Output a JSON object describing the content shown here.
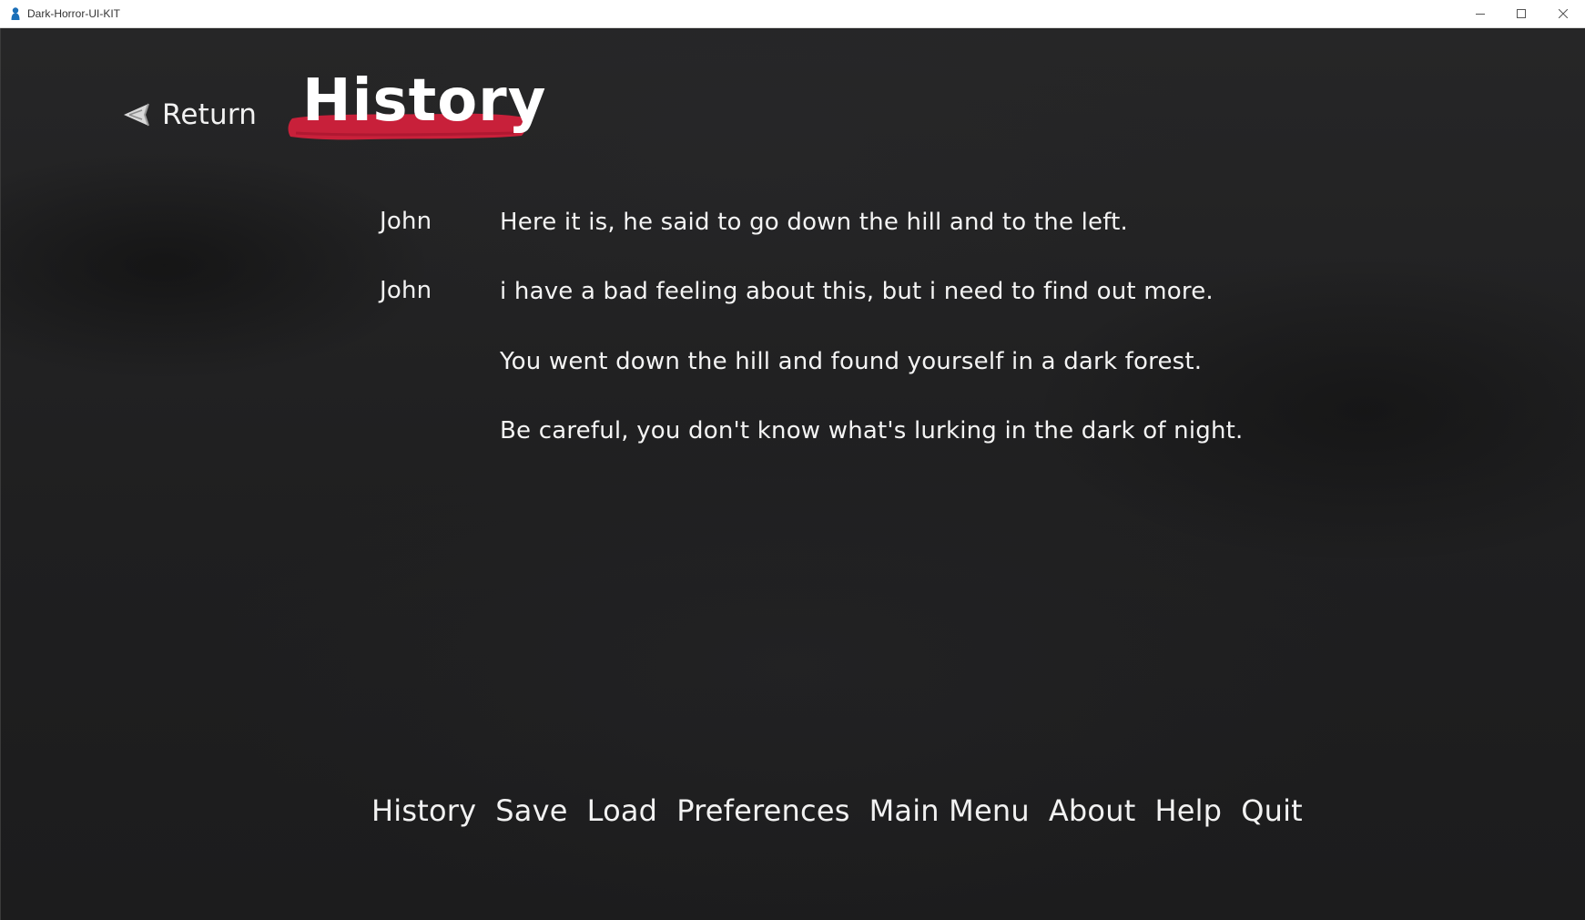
{
  "window": {
    "title": "Dark-Horror-UI-KIT",
    "controls": [
      "minimize-icon",
      "maximize-icon",
      "close-icon"
    ]
  },
  "screen": {
    "return_label": "Return",
    "title": "History",
    "accent_color": "#c8203a"
  },
  "history": [
    {
      "who": "John",
      "what": "Here it is, he said to go down the hill and to the left."
    },
    {
      "who": "John",
      "what": "i have a bad feeling about this, but i need to find out more."
    },
    {
      "who": "",
      "what": "You went down the hill and found yourself in a dark forest."
    },
    {
      "who": "",
      "what": "Be careful, you don't know what's lurking in the dark of night."
    }
  ],
  "nav": {
    "items": [
      "History",
      "Save",
      "Load",
      "Preferences",
      "Main Menu",
      "About",
      "Help",
      "Quit"
    ]
  }
}
